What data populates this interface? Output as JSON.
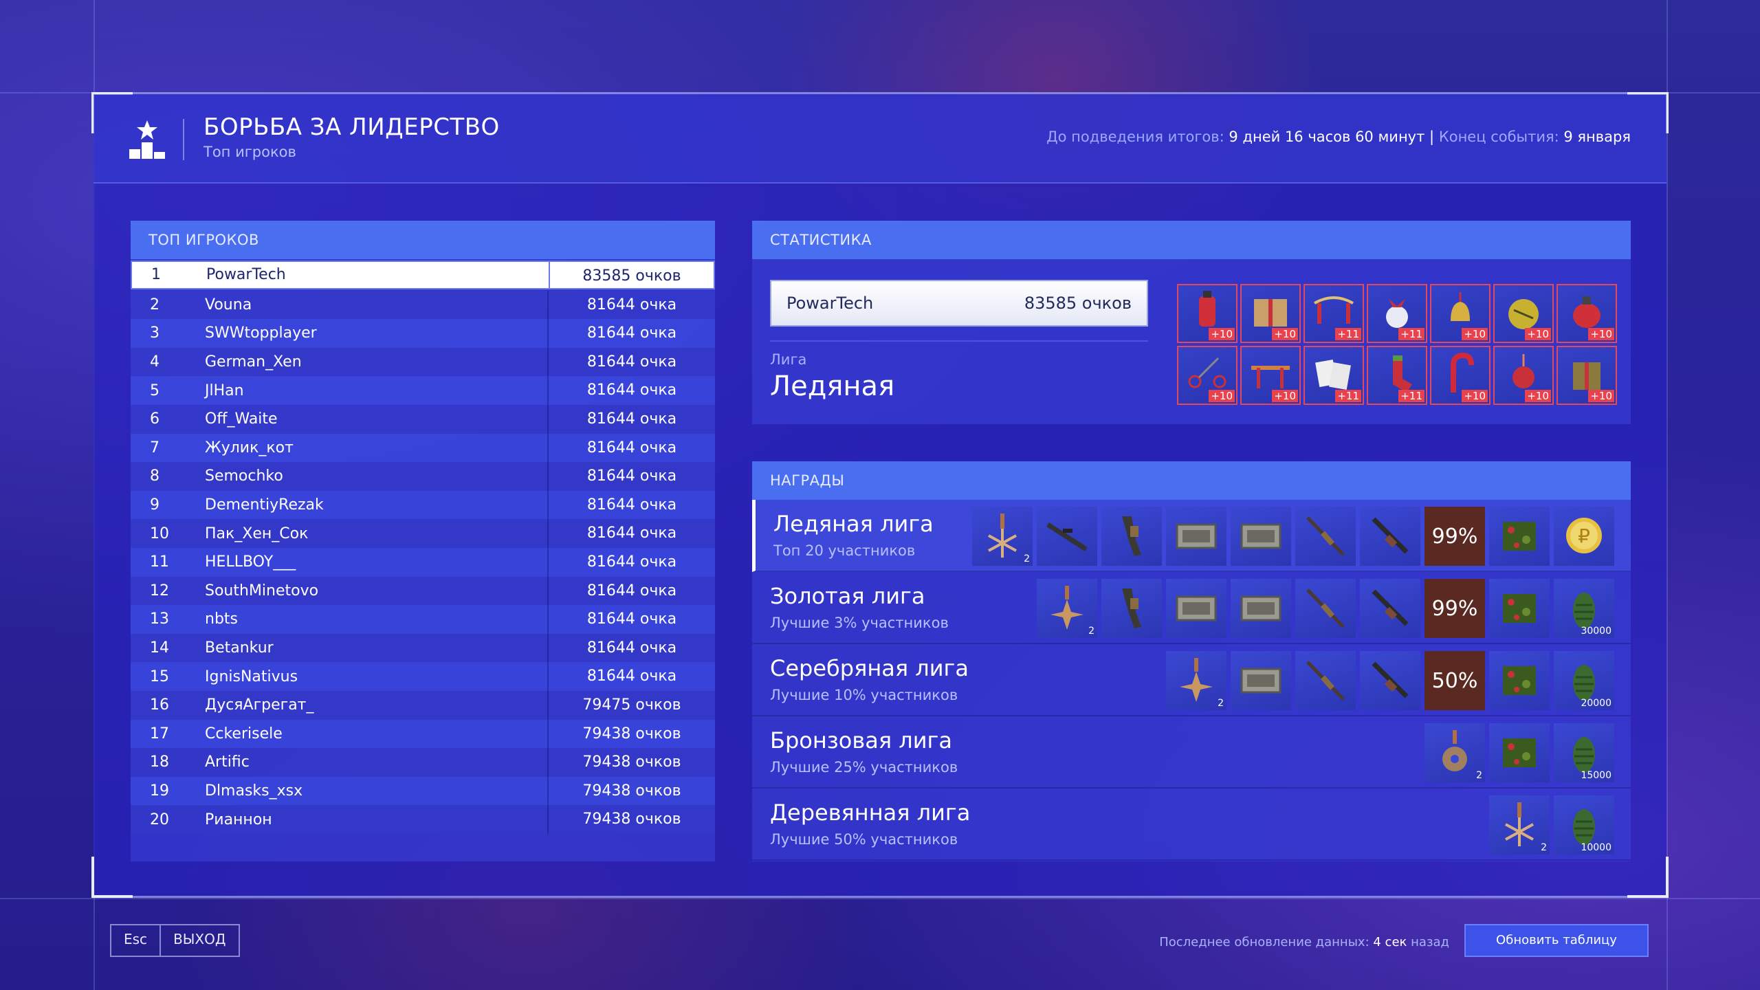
{
  "header": {
    "title": "БОРЬБА ЗА ЛИДЕРСТВО",
    "subtitle": "Топ игроков",
    "countdown_label": "До подведения итогов:",
    "countdown_value": "9 дней 16 часов 60 минут",
    "divider": "|",
    "end_label": "Конец события:",
    "end_value": "9 января"
  },
  "leaderboard": {
    "title": "ТОП ИГРОКОВ",
    "rows": [
      {
        "rank": "1",
        "name": "PowarTech",
        "points": "83585 очков"
      },
      {
        "rank": "2",
        "name": "Vouna",
        "points": "81644 очка"
      },
      {
        "rank": "3",
        "name": "SWWtopplayer",
        "points": "81644 очка"
      },
      {
        "rank": "4",
        "name": "German_Xen",
        "points": "81644 очка"
      },
      {
        "rank": "5",
        "name": "JlHan",
        "points": "81644 очка"
      },
      {
        "rank": "6",
        "name": "Off_Waite",
        "points": "81644 очка"
      },
      {
        "rank": "7",
        "name": "Жулик_кот",
        "points": "81644 очка"
      },
      {
        "rank": "8",
        "name": "Semochko",
        "points": "81644 очка"
      },
      {
        "rank": "9",
        "name": "DementiyRezak",
        "points": "81644 очка"
      },
      {
        "rank": "10",
        "name": "Пак_Хен_Сок",
        "points": "81644 очка"
      },
      {
        "rank": "11",
        "name": "HELLBOY___",
        "points": "81644 очка"
      },
      {
        "rank": "12",
        "name": "SouthMinetovo",
        "points": "81644 очка"
      },
      {
        "rank": "13",
        "name": "nbts",
        "points": "81644 очка"
      },
      {
        "rank": "14",
        "name": "Betankur",
        "points": "81644 очка"
      },
      {
        "rank": "15",
        "name": "IgnisNativus",
        "points": "81644 очка"
      },
      {
        "rank": "16",
        "name": "ДусяАгрегат_",
        "points": "79475 очков"
      },
      {
        "rank": "17",
        "name": "Cckerisele",
        "points": "79438 очков"
      },
      {
        "rank": "18",
        "name": "Artific",
        "points": "79438 очков"
      },
      {
        "rank": "19",
        "name": "Dlmasks_xsx",
        "points": "79438 очков"
      },
      {
        "rank": "20",
        "name": "Рианнон",
        "points": "79438 очков"
      }
    ]
  },
  "stats": {
    "title": "СТАТИСТИКА",
    "player_name": "PowarTech",
    "player_points": "83585 очков",
    "league_label": "Лига",
    "league_value": "Ледяная",
    "items": [
      {
        "icon": "red-toy-icon",
        "badge": "+10"
      },
      {
        "icon": "gift-box-icon",
        "badge": "+10"
      },
      {
        "icon": "ribbon-bow-icon",
        "badge": "+11"
      },
      {
        "icon": "snowball-bow-icon",
        "badge": "+11"
      },
      {
        "icon": "bell-icon",
        "badge": "+10"
      },
      {
        "icon": "golden-ornament-icon",
        "badge": "+10"
      },
      {
        "icon": "red-grenade-icon",
        "badge": "+10"
      },
      {
        "icon": "scissors-icon",
        "badge": "+10"
      },
      {
        "icon": "ribbon-icon",
        "badge": "+10"
      },
      {
        "icon": "playing-cards-icon",
        "badge": "+11"
      },
      {
        "icon": "red-sock-icon",
        "badge": "+11"
      },
      {
        "icon": "candy-cane-icon",
        "badge": "+10"
      },
      {
        "icon": "ornament-icon",
        "badge": "+10"
      },
      {
        "icon": "present-icon",
        "badge": "+10"
      }
    ]
  },
  "rewards": {
    "title": "НАГРАДЫ",
    "leagues": [
      {
        "name": "Ледяная лига",
        "desc": "Топ 20 участников",
        "items": [
          {
            "icon": "snowflake-medal-icon",
            "count": "2"
          },
          {
            "icon": "sniper-rifle-icon",
            "count": ""
          },
          {
            "icon": "pistol-icon",
            "count": ""
          },
          {
            "icon": "weapon-case-icon",
            "count": ""
          },
          {
            "icon": "weapon-case-icon",
            "count": ""
          },
          {
            "icon": "rifle-icon",
            "count": ""
          },
          {
            "icon": "assault-rifle-icon",
            "count": ""
          },
          {
            "icon": "percent-icon",
            "label": "99%"
          },
          {
            "icon": "camo-crate-icon",
            "count": ""
          },
          {
            "icon": "coin-icon",
            "count": ""
          }
        ]
      },
      {
        "name": "Золотая лига",
        "desc": "Лучшие 3% участников",
        "items": [
          {
            "icon": "star-medal-icon",
            "count": "2"
          },
          {
            "icon": "pistol-icon",
            "count": ""
          },
          {
            "icon": "weapon-case-icon",
            "count": ""
          },
          {
            "icon": "weapon-case-icon",
            "count": ""
          },
          {
            "icon": "rifle-icon",
            "count": ""
          },
          {
            "icon": "assault-rifle-icon",
            "count": ""
          },
          {
            "icon": "percent-icon",
            "label": "99%"
          },
          {
            "icon": "camo-crate-icon",
            "count": ""
          },
          {
            "icon": "pine-cone-icon",
            "count": "30000"
          }
        ]
      },
      {
        "name": "Серебряная лига",
        "desc": "Лучшие 10% участников",
        "items": [
          {
            "icon": "star-medal-icon",
            "count": "2"
          },
          {
            "icon": "weapon-case-icon",
            "count": ""
          },
          {
            "icon": "rifle-icon",
            "count": ""
          },
          {
            "icon": "assault-rifle-icon",
            "count": ""
          },
          {
            "icon": "percent-icon",
            "label": "50%"
          },
          {
            "icon": "camo-crate-icon",
            "count": ""
          },
          {
            "icon": "pine-cone-icon",
            "count": "20000"
          }
        ]
      },
      {
        "name": "Бронзовая лига",
        "desc": "Лучшие 25% участников",
        "items": [
          {
            "icon": "gear-medal-icon",
            "count": "2"
          },
          {
            "icon": "camo-crate-icon",
            "count": ""
          },
          {
            "icon": "pine-cone-icon",
            "count": "15000"
          }
        ]
      },
      {
        "name": "Деревянная лига",
        "desc": "Лучшие 50% участников",
        "items": [
          {
            "icon": "snowflake-medal-icon",
            "count": "2"
          },
          {
            "icon": "pine-cone-icon",
            "count": "10000"
          }
        ]
      }
    ]
  },
  "footer": {
    "esc_label": "Esc",
    "exit_label": "ВЫХОД",
    "update_label": "Последнее обновление данных:",
    "update_value": "4 сек",
    "update_suffix": "назад",
    "refresh_label": "Обновить таблицу"
  },
  "colors": {
    "accent": "#4a6ef0",
    "badge": "#e8424f",
    "percent_bg": "#5a2a22"
  }
}
